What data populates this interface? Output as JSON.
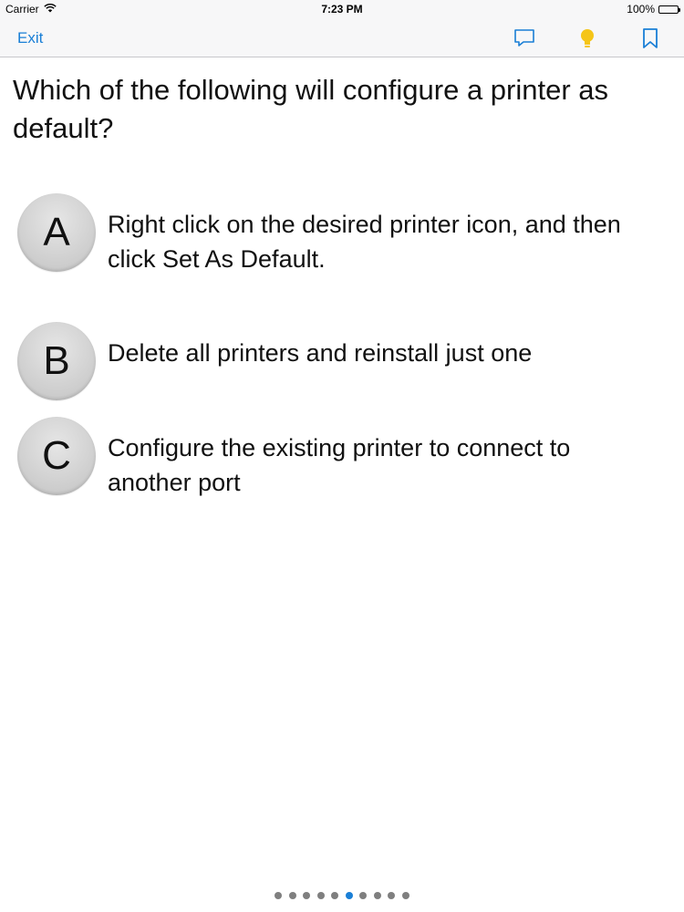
{
  "status_bar": {
    "carrier": "Carrier",
    "time": "7:23 PM",
    "battery": "100%"
  },
  "nav": {
    "exit_label": "Exit",
    "accent_color": "#1a7fd6",
    "hint_color": "#f5c518",
    "icons": [
      "speech-bubble-icon",
      "lightbulb-icon",
      "bookmark-icon"
    ]
  },
  "question": {
    "text": "Which of the following will configure a printer as default?"
  },
  "answers": [
    {
      "letter": "A",
      "text": "Right click on the desired printer icon, and then click Set As Default."
    },
    {
      "letter": "B",
      "text": "Delete all printers and reinstall just one"
    },
    {
      "letter": "C",
      "text": "Configure the existing printer to connect to another port"
    }
  ],
  "pagination": {
    "total": 10,
    "current": 6
  }
}
